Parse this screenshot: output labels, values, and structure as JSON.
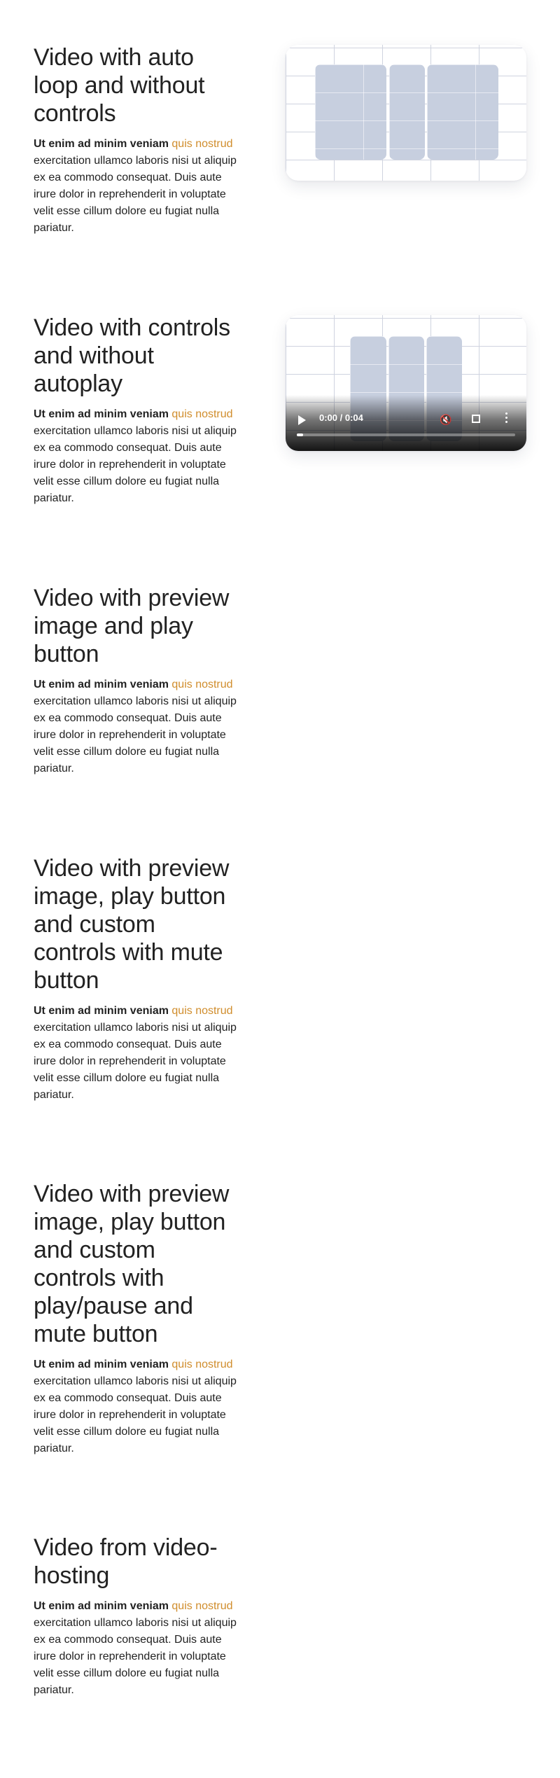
{
  "sections": [
    {
      "title": "Video with auto loop and without controls",
      "desc_lead": "Ut enim ad minim veniam",
      "desc_link": "quis nostrud",
      "desc_rest": "exercitation ullamco laboris nisi ut aliquip ex ea commodo consequat. Duis aute irure dolor in reprehenderit in voluptate velit esse cillum dolore eu fugiat nulla pariatur."
    },
    {
      "title": "Video with controls and without autoplay",
      "desc_lead": "Ut enim ad minim veniam",
      "desc_link": "quis nostrud",
      "desc_rest": "exercitation ullamco laboris nisi ut aliquip ex ea commodo consequat. Duis aute irure dolor in reprehenderit in voluptate velit esse cillum dolore eu fugiat nulla pariatur.",
      "player": {
        "time": "0:00 / 0:04",
        "progress": 0.03,
        "play_icon": "play-icon",
        "mute_icon": "volume-icon",
        "fullscreen_icon": "fullscreen-icon",
        "more_icon": "more-options-icon"
      }
    },
    {
      "title": "Video with preview image and play button",
      "desc_lead": "Ut enim ad minim veniam",
      "desc_link": "quis nostrud",
      "desc_rest": "exercitation ullamco laboris nisi ut aliquip ex ea commodo consequat. Duis aute irure dolor in reprehenderit in voluptate velit esse cillum dolore eu fugiat nulla pariatur."
    },
    {
      "title": "Video with preview image, play button and custom controls with mute button",
      "desc_lead": "Ut enim ad minim veniam",
      "desc_link": "quis nostrud",
      "desc_rest": "exercitation ullamco laboris nisi ut aliquip ex ea commodo consequat. Duis aute irure dolor in reprehenderit in voluptate velit esse cillum dolore eu fugiat nulla pariatur."
    },
    {
      "title": "Video with preview image, play button and custom controls with play/pause and mute button",
      "desc_lead": "Ut enim ad minim veniam",
      "desc_link": "quis nostrud",
      "desc_rest": "exercitation ullamco laboris nisi ut aliquip ex ea commodo consequat. Duis aute irure dolor in reprehenderit in voluptate velit esse cillum dolore eu fugiat nulla pariatur."
    },
    {
      "title": "Video from video-hosting",
      "desc_lead": "Ut enim ad minim veniam",
      "desc_link": "quis nostrud",
      "desc_rest": "exercitation ullamco laboris nisi ut aliquip ex ea commodo consequat. Duis aute irure dolor in reprehenderit in voluptate velit esse cillum dolore eu fugiat nulla pariatur."
    }
  ],
  "colors": {
    "text": "#222222",
    "link": "#d08d2c",
    "video_tile": "#c7cfdf",
    "grid_line": "#cfd3df"
  }
}
